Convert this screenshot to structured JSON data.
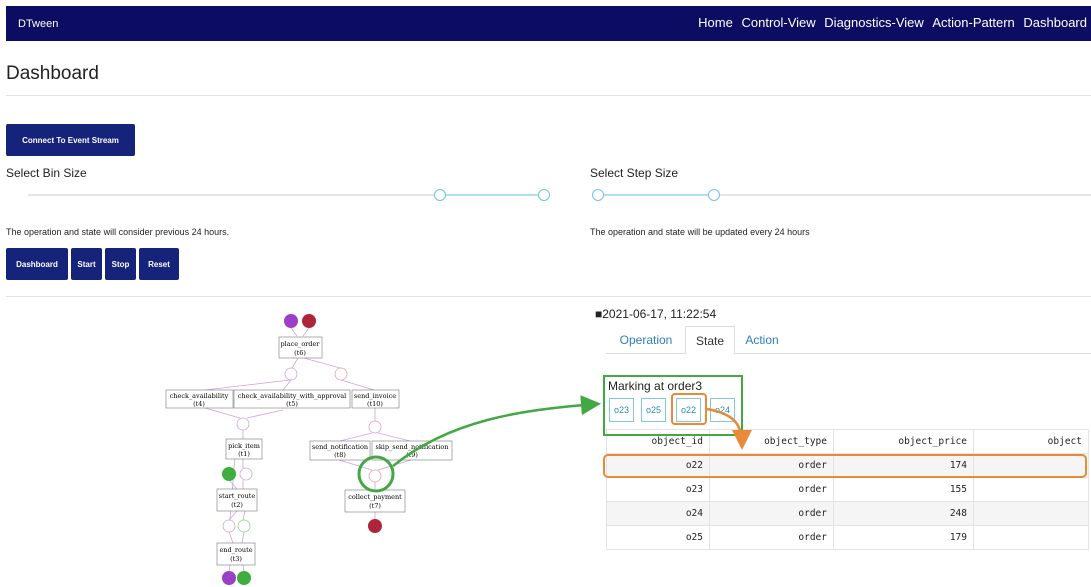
{
  "navbar": {
    "brand": "DTween",
    "links": [
      "Home",
      "Control-View",
      "Diagnostics-View",
      "Action-Pattern",
      "Dashboard"
    ]
  },
  "page": {
    "title": "Dashboard"
  },
  "connect_button": "Connect To Event Stream",
  "bin_size": {
    "label": "Select Bin Size",
    "note": "The operation and state will consider previous 24 hours."
  },
  "step_size": {
    "label": "Select Step Size",
    "note": "The operation and state will be updated every 24 hours"
  },
  "controls": {
    "dashboard": "Dashboard",
    "start": "Start",
    "stop": "Stop",
    "reset": "Reset"
  },
  "timestamp": "■2021-06-17, 11:22:54",
  "tabs": {
    "operation": "Operation",
    "state": "State",
    "action": "Action",
    "active": "State"
  },
  "marking": {
    "title": "Marking at order3",
    "objects": [
      "o23",
      "o25",
      "o22",
      "o24"
    ]
  },
  "table": {
    "headers": [
      "object_id",
      "object_type",
      "object_price",
      "object"
    ],
    "rows": [
      [
        "o22",
        "order",
        "174",
        ""
      ],
      [
        "o23",
        "order",
        "155",
        ""
      ],
      [
        "o24",
        "order",
        "248",
        ""
      ],
      [
        "o25",
        "order",
        "179",
        ""
      ]
    ]
  },
  "petri_net": {
    "transitions": [
      {
        "name": "place_order",
        "id": "(t6)"
      },
      {
        "name": "check_availability",
        "id": "(t4)"
      },
      {
        "name": "check_availability_with_approval",
        "id": "(t5)"
      },
      {
        "name": "send_invoice",
        "id": "(t10)"
      },
      {
        "name": "pick_item",
        "id": "(t1)"
      },
      {
        "name": "send_notification",
        "id": "(t8)"
      },
      {
        "name": "skip_send_notification",
        "id": "(t9)"
      },
      {
        "name": "start_route",
        "id": "(t2)"
      },
      {
        "name": "collect_payment",
        "id": "(t7)"
      },
      {
        "name": "end_route",
        "id": "(t3)"
      }
    ],
    "colors": {
      "purple": "#9b3fc7",
      "red": "#b0243a",
      "green": "#3fae3f"
    }
  },
  "colors": {
    "navbar": "#0c0c63",
    "button": "#16237b",
    "link": "#2a7ec1",
    "highlight_green": "#43a843",
    "highlight_orange": "#e88a39"
  }
}
